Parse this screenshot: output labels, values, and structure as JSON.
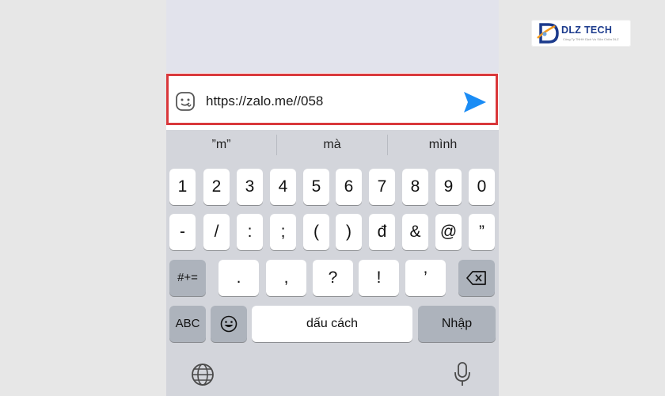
{
  "logo": {
    "text": "DLZ TECH",
    "tagline": "Công Ty TNHH Dịch Vụ Sửa Chữa DLZ"
  },
  "input": {
    "value": "https://zalo.me//058"
  },
  "suggestions": [
    "”m”",
    "mà",
    "mình"
  ],
  "keyboard": {
    "row1": [
      "1",
      "2",
      "3",
      "4",
      "5",
      "6",
      "7",
      "8",
      "9",
      "0"
    ],
    "row2": [
      "-",
      "/",
      ":",
      ";",
      "(",
      ")",
      "đ",
      "&",
      "@",
      "”"
    ],
    "row3": [
      ".",
      ",",
      "?",
      "!",
      "’"
    ],
    "toggle_symbols": "#+=",
    "toggle_letters": "ABC",
    "space": "dấu cách",
    "return": "Nhập"
  },
  "icons": {
    "emoji_button": "sticker-face-icon",
    "send_button": "send-arrow-icon",
    "backspace": "backspace-icon",
    "emoji_key": "emoji-icon",
    "globe": "globe-icon",
    "mic": "microphone-icon"
  },
  "colors": {
    "highlight": "#d9383b",
    "send": "#1a8cf5",
    "keyboard_bg": "#d3d5db",
    "brand": "#1b3a8c"
  }
}
